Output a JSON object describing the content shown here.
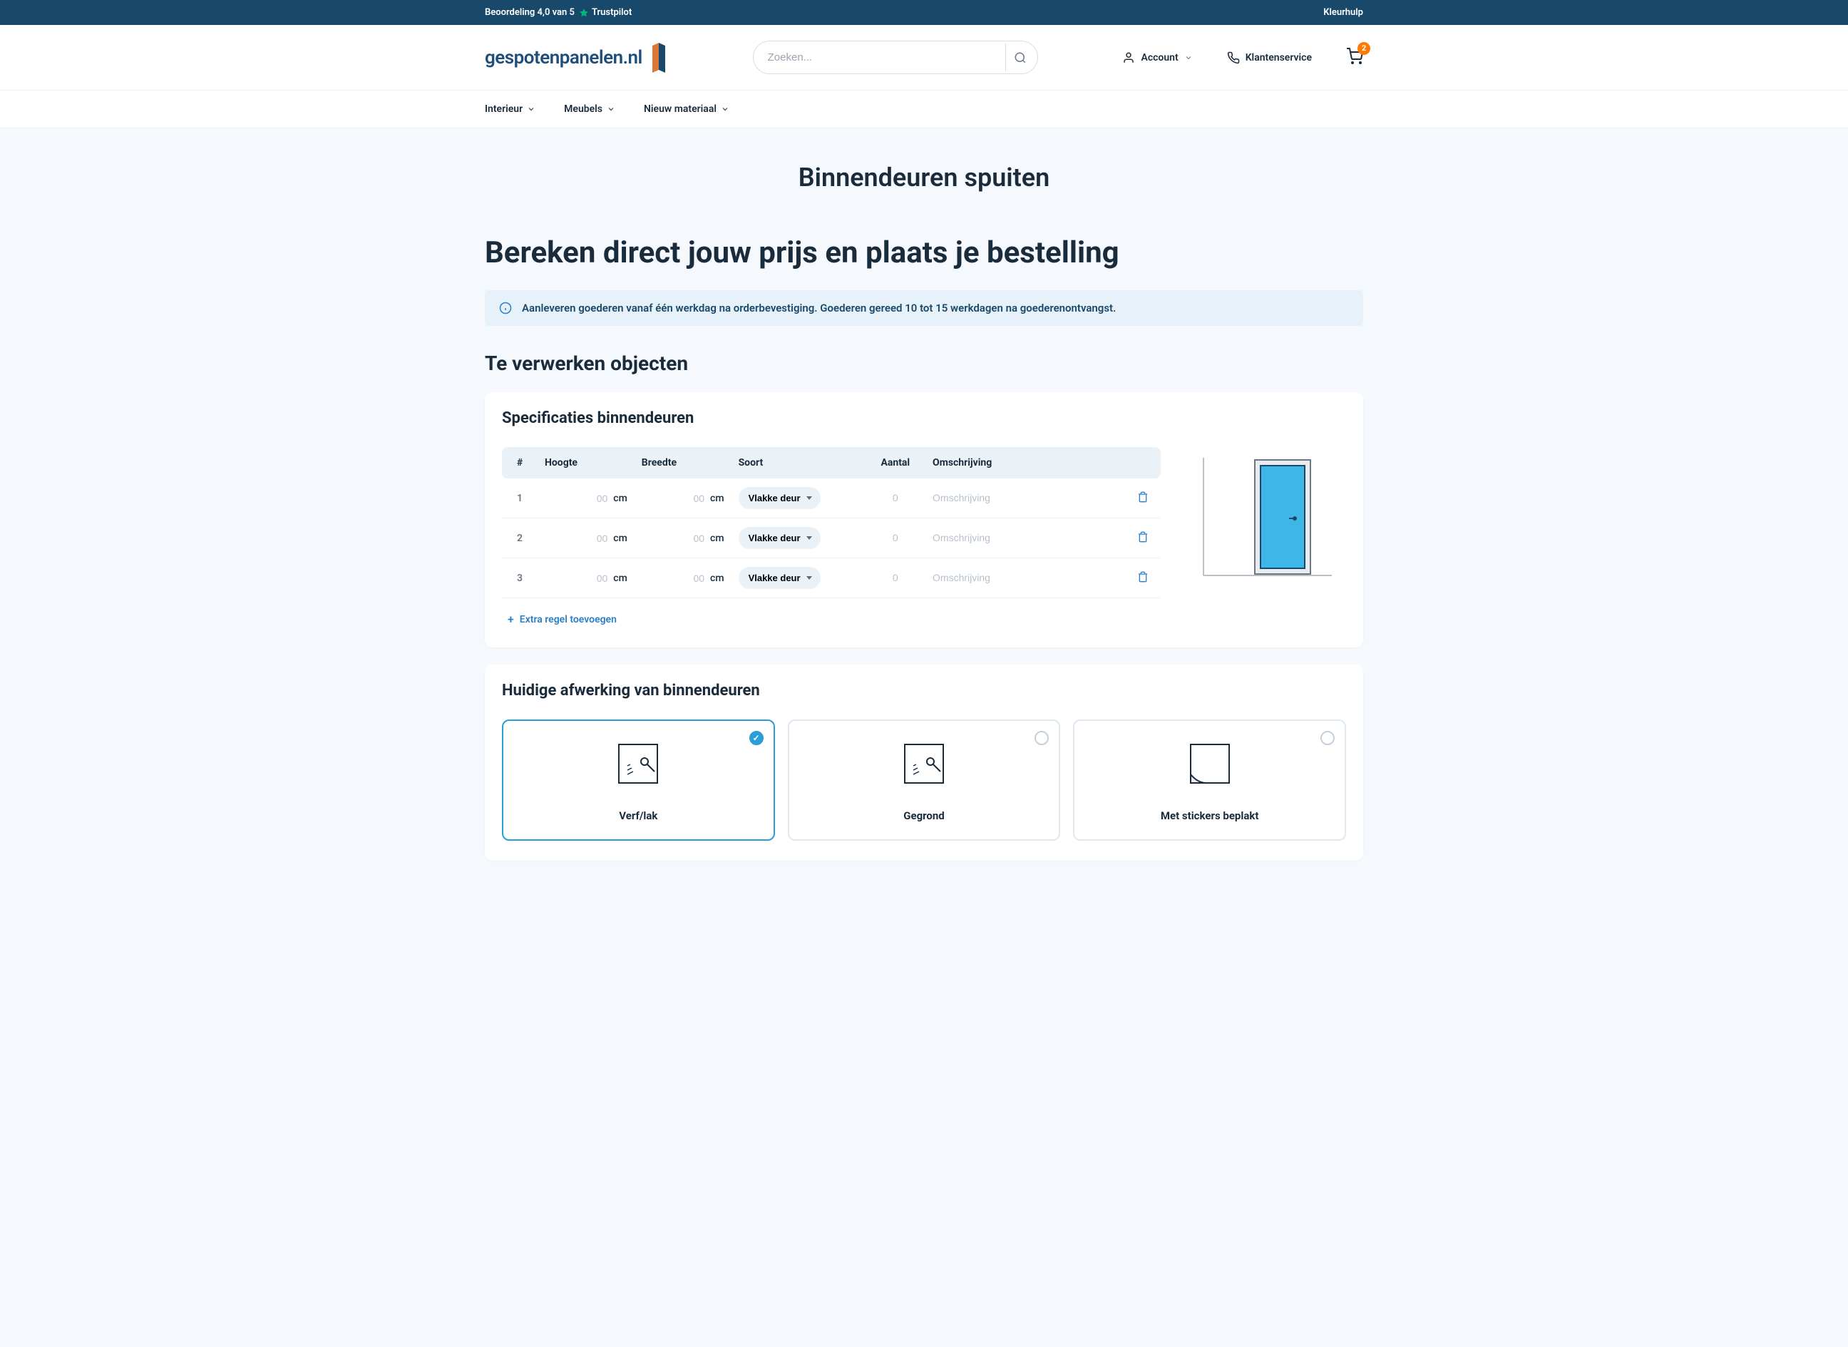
{
  "topbar": {
    "rating_text": "Beoordeling 4,0 van 5",
    "trustpilot_label": "Trustpilot",
    "color_help": "Kleurhulp"
  },
  "header": {
    "logo_text": "gespotenpanelen.nl",
    "search_placeholder": "Zoeken...",
    "account_label": "Account",
    "service_label": "Klantenservice",
    "cart_count": "2"
  },
  "nav": {
    "items": [
      {
        "label": "Interieur"
      },
      {
        "label": "Meubels"
      },
      {
        "label": "Nieuw materiaal"
      }
    ]
  },
  "page": {
    "title": "Binnendeuren spuiten",
    "subtitle": "Bereken direct jouw prijs en plaats je bestelling",
    "info_banner": "Aanleveren goederen vanaf één werkdag na orderbevestiging. Goederen gereed 10 tot 15 werkdagen na goederenontvangst.",
    "section_objects": "Te verwerken objecten"
  },
  "spec_card": {
    "title": "Specificaties binnendeuren",
    "headers": {
      "num": "#",
      "height": "Hoogte",
      "width": "Breedte",
      "type": "Soort",
      "qty": "Aantal",
      "desc": "Omschrijving"
    },
    "unit": "cm",
    "dim_placeholder": "00",
    "qty_placeholder": "0",
    "desc_placeholder": "Omschrijving",
    "type_default": "Vlakke deur",
    "rows": [
      {
        "num": "1"
      },
      {
        "num": "2"
      },
      {
        "num": "3"
      }
    ],
    "add_row": "Extra regel toevoegen"
  },
  "finish_card": {
    "title": "Huidige afwerking van binnendeuren",
    "options": [
      {
        "label": "Verf/lak",
        "selected": true
      },
      {
        "label": "Gegrond",
        "selected": false
      },
      {
        "label": "Met stickers beplakt",
        "selected": false
      }
    ]
  },
  "colors": {
    "brand_primary": "#19496a",
    "brand_accent": "#2a9ed8",
    "orange": "#ff7a00",
    "green": "#00b67a"
  }
}
